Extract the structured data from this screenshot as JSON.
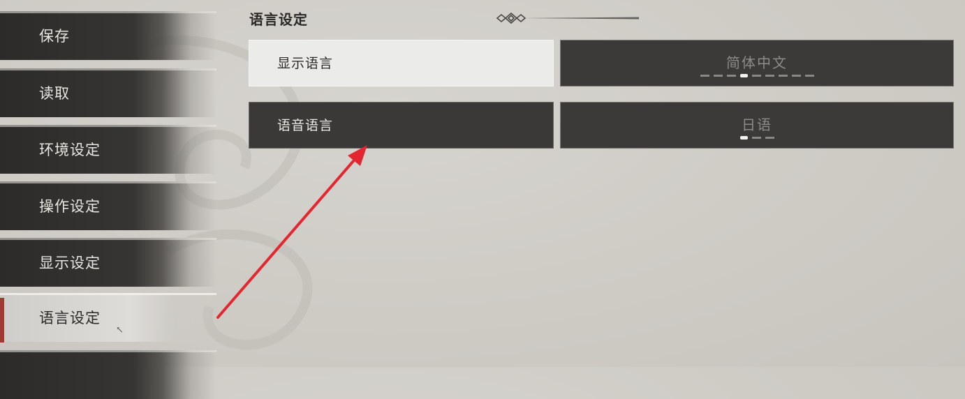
{
  "sidebar": {
    "items": [
      {
        "label": "保存"
      },
      {
        "label": "读取"
      },
      {
        "label": "环境设定"
      },
      {
        "label": "操作设定"
      },
      {
        "label": "显示设定"
      },
      {
        "label": "语言设定",
        "active": true
      }
    ]
  },
  "section": {
    "title": "语言设定"
  },
  "options": [
    {
      "label": "显示语言",
      "value": "简体中文",
      "option_count": 9,
      "selected_index": 3,
      "focused": true
    },
    {
      "label": "语音语言",
      "value": "日语",
      "option_count": 3,
      "selected_index": 0,
      "focused": false
    }
  ],
  "colors": {
    "accent_red": "#a23a33",
    "annotation_arrow": "#e3262f",
    "panel_dark": "#3a3937",
    "panel_light": "#ebebea"
  }
}
